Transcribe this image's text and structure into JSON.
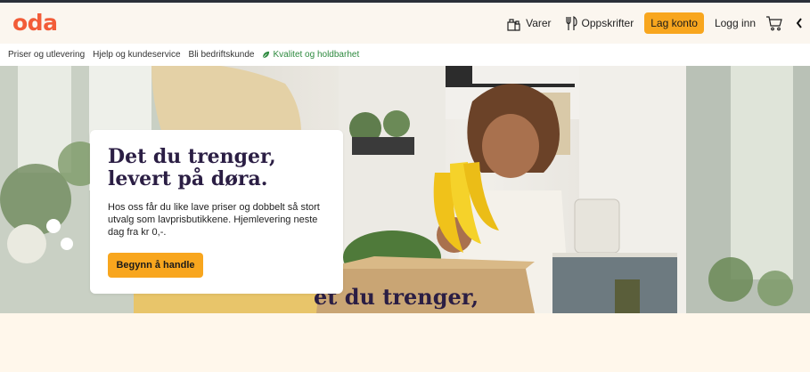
{
  "brand": {
    "logo": "oda",
    "color": "#f25c38"
  },
  "header": {
    "products_label": "Varer",
    "products_icon": "grocery-bag-icon",
    "recipes_label": "Oppskrifter",
    "recipes_icon": "fork-knife-icon",
    "signup_label": "Lag konto",
    "login_label": "Logg inn",
    "cart_icon": "cart-icon",
    "collapse_icon": "chevron-left-icon"
  },
  "subnav": {
    "items": [
      {
        "label": "Priser og utlevering"
      },
      {
        "label": "Hjelp og kundeservice"
      },
      {
        "label": "Bli bedriftskunde"
      },
      {
        "label": "Kvalitet og holdbarhet",
        "icon": "leaf-icon",
        "color": "#2e8a3f"
      }
    ]
  },
  "hero": {
    "title": "Det du trenger, levert på døra.",
    "body": "Hos oss får du like lave priser og dobbelt så stort utvalg som lavprisbutikkene. Hjemlevering neste dag fra kr 0,-.",
    "cta_label": "Begynn å handle",
    "cta_color": "#f8a61e",
    "image_alt": "Girl holding bananas next to grocery box in kitchen",
    "box_text": "et du trenger,"
  }
}
